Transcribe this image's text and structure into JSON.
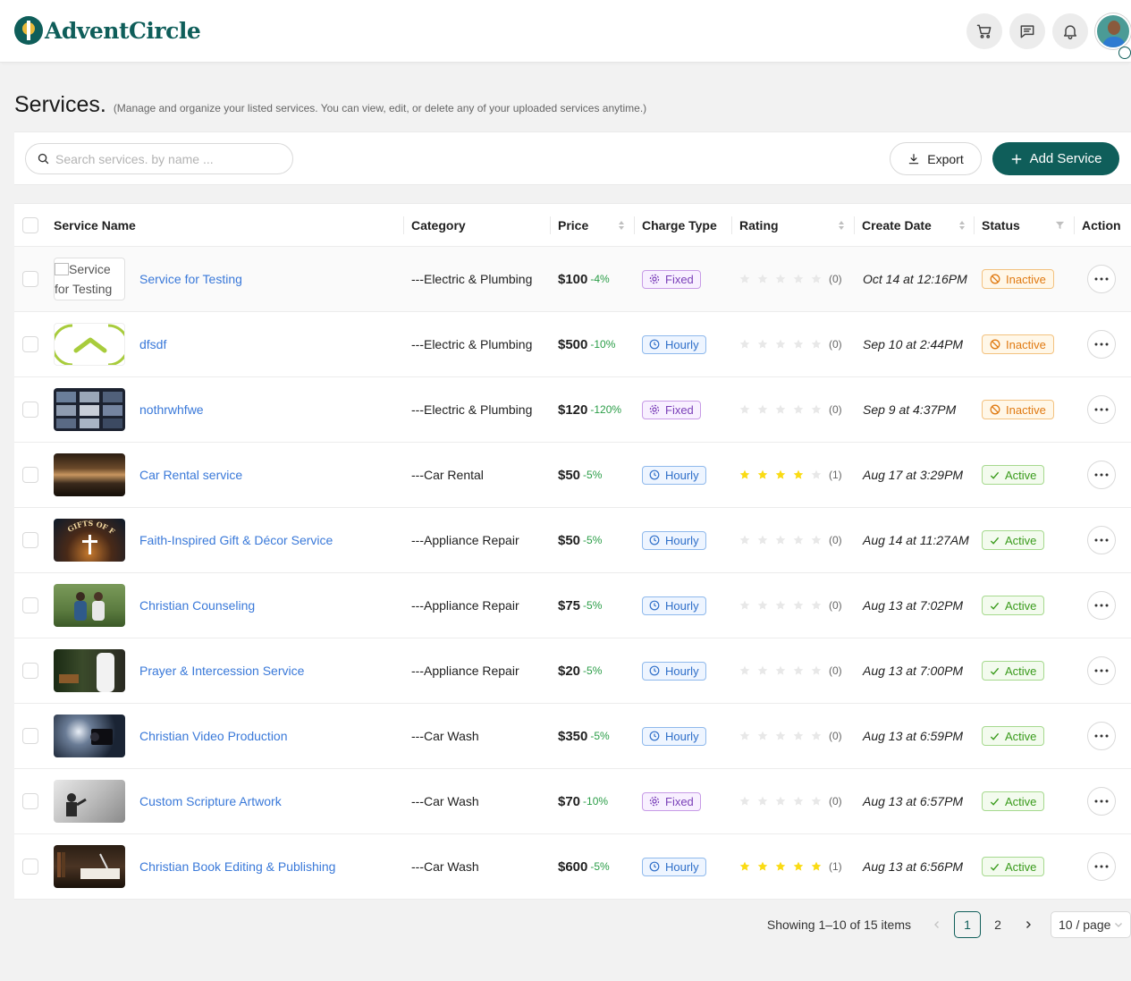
{
  "header": {
    "brand": "AdventCircle",
    "icons": [
      "cart-icon",
      "message-icon",
      "bell-icon"
    ]
  },
  "page": {
    "title": "Services.",
    "subtitle": "(Manage and organize your listed services. You can view, edit, or delete any of your uploaded services anytime.)"
  },
  "toolbar": {
    "search_placeholder": "Search services. by name ...",
    "search_value": "",
    "export_label": "Export",
    "add_label": "Add Service"
  },
  "table": {
    "columns": {
      "service_name": "Service Name",
      "category": "Category",
      "price": "Price",
      "charge_type": "Charge Type",
      "rating": "Rating",
      "create_date": "Create Date",
      "status": "Status",
      "action": "Action"
    },
    "rows": [
      {
        "name": "Service for Testing",
        "image_alt": "Service for Testing",
        "image": "broken",
        "category": "---Electric & Plumbing",
        "price": "$100",
        "discount": "-4%",
        "charge": "Fixed",
        "rating": 0,
        "rating_count": "(0)",
        "date": "Oct 14 at 12:16PM",
        "status": "Inactive"
      },
      {
        "name": "dfsdf",
        "image": "logo",
        "category": "---Electric & Plumbing",
        "price": "$500",
        "discount": "-10%",
        "charge": "Hourly",
        "rating": 0,
        "rating_count": "(0)",
        "date": "Sep 10 at 2:44PM",
        "status": "Inactive"
      },
      {
        "name": "nothrwhfwe",
        "image": "grid",
        "category": "---Electric & Plumbing",
        "price": "$120",
        "discount": "-120%",
        "charge": "Fixed",
        "rating": 0,
        "rating_count": "(0)",
        "date": "Sep 9 at 4:37PM",
        "status": "Inactive"
      },
      {
        "name": "Car Rental service",
        "image": "lake",
        "category": "---Car Rental",
        "price": "$50",
        "discount": "-5%",
        "charge": "Hourly",
        "rating": 4,
        "rating_count": "(1)",
        "date": "Aug 17 at 3:29PM",
        "status": "Active"
      },
      {
        "name": "Faith-Inspired Gift & Décor Service",
        "image": "gifts",
        "image_text": "GIFTS OF FAITH",
        "category": "---Appliance Repair",
        "price": "$50",
        "discount": "-5%",
        "charge": "Hourly",
        "rating": 0,
        "rating_count": "(0)",
        "date": "Aug 14 at 11:27AM",
        "status": "Active"
      },
      {
        "name": "Christian Counseling",
        "image": "people",
        "category": "---Appliance Repair",
        "price": "$75",
        "discount": "-5%",
        "charge": "Hourly",
        "rating": 0,
        "rating_count": "(0)",
        "date": "Aug 13 at 7:02PM",
        "status": "Active"
      },
      {
        "name": "Prayer & Intercession Service",
        "image": "prayer",
        "category": "---Appliance Repair",
        "price": "$20",
        "discount": "-5%",
        "charge": "Hourly",
        "rating": 0,
        "rating_count": "(0)",
        "date": "Aug 13 at 7:00PM",
        "status": "Active"
      },
      {
        "name": "Christian Video Production",
        "image": "camera",
        "category": "---Car Wash",
        "price": "$350",
        "discount": "-5%",
        "charge": "Hourly",
        "rating": 0,
        "rating_count": "(0)",
        "date": "Aug 13 at 6:59PM",
        "status": "Active"
      },
      {
        "name": "Custom Scripture Artwork",
        "image": "art",
        "category": "---Car Wash",
        "price": "$70",
        "discount": "-10%",
        "charge": "Fixed",
        "rating": 0,
        "rating_count": "(0)",
        "date": "Aug 13 at 6:57PM",
        "status": "Active"
      },
      {
        "name": "Christian Book Editing & Publishing",
        "image": "book",
        "category": "---Car Wash",
        "price": "$600",
        "discount": "-5%",
        "charge": "Hourly",
        "rating": 5,
        "rating_count": "(1)",
        "date": "Aug 13 at 6:56PM",
        "status": "Active"
      }
    ]
  },
  "pagination": {
    "info": "Showing 1–10 of 15 items",
    "pages": [
      "1",
      "2"
    ],
    "current": "1",
    "page_size": "10 / page"
  },
  "colors": {
    "brand": "#0f5e5a",
    "link": "#3a79d9",
    "discount": "#2a9d47",
    "star_filled": "#fadb14",
    "star_empty": "#e8e8e8"
  }
}
